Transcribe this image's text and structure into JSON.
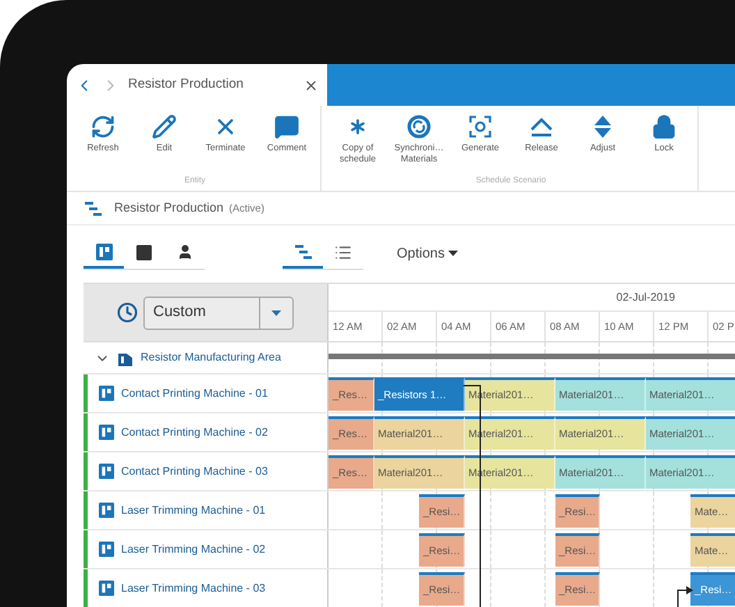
{
  "tab": {
    "title": "Resistor Production"
  },
  "ribbon": {
    "groups": [
      {
        "label": "Entity",
        "buttons": [
          {
            "kind": "refresh",
            "label": "Refresh"
          },
          {
            "kind": "edit",
            "label": "Edit"
          },
          {
            "kind": "terminate",
            "label": "Terminate"
          },
          {
            "kind": "comment",
            "label": "Comment"
          }
        ]
      },
      {
        "label": "Schedule Scenario",
        "buttons": [
          {
            "kind": "copy",
            "label": "Copy of schedule"
          },
          {
            "kind": "sync",
            "label": "Synchroni… Materials"
          },
          {
            "kind": "generate",
            "label": "Generate"
          },
          {
            "kind": "release",
            "label": "Release"
          },
          {
            "kind": "adjust",
            "label": "Adjust"
          },
          {
            "kind": "lock",
            "label": "Lock"
          }
        ]
      }
    ]
  },
  "schedule_title": {
    "name": "Resistor Production",
    "status": "(Active)"
  },
  "view_tabs": [
    {
      "kind": "resource",
      "selected": true
    },
    {
      "kind": "square",
      "selected": false
    },
    {
      "kind": "person",
      "selected": false
    }
  ],
  "mode_tabs": [
    {
      "kind": "gantt",
      "selected": true
    },
    {
      "kind": "list",
      "selected": false
    }
  ],
  "options_menu": {
    "label": "Options"
  },
  "range_select": {
    "value": "Custom"
  },
  "timeline": {
    "date": "02-Jul-2019",
    "hours": [
      "12 AM",
      "02 AM",
      "04 AM",
      "06 AM",
      "08 AM",
      "10 AM",
      "12 PM",
      "02 P"
    ]
  },
  "group": {
    "name": "Resistor Manufacturing Area",
    "expanded": true,
    "resources": [
      {
        "name": "Contact Printing Machine - 01",
        "bars": [
          {
            "kind": "bar",
            "long": false,
            "label": "_Res…",
            "color": "#e9a98b"
          },
          {
            "kind": "bar",
            "long": true,
            "label": "_Resistors 1…",
            "color": "#1f7cc1"
          },
          {
            "kind": "bar",
            "long": true,
            "label": "Material201…",
            "color": "#e7e49d"
          },
          {
            "kind": "bar",
            "long": true,
            "label": "Material201…",
            "color": "#a4e0dc"
          },
          {
            "kind": "bar",
            "long": true,
            "label": "Material201…",
            "color": "#a4e0dc"
          }
        ]
      },
      {
        "name": "Contact Printing Machine - 02",
        "bars": [
          {
            "kind": "bar",
            "long": false,
            "label": "_Res…",
            "color": "#e9a98b"
          },
          {
            "kind": "bar",
            "long": true,
            "label": "Material201…",
            "color": "#ebd49d"
          },
          {
            "kind": "bar",
            "long": true,
            "label": "Material201…",
            "color": "#e7e49d"
          },
          {
            "kind": "bar",
            "long": true,
            "label": "Material201…",
            "color": "#e7e49d"
          },
          {
            "kind": "bar",
            "long": true,
            "label": "Material201…",
            "color": "#a4e0dc"
          }
        ]
      },
      {
        "name": "Contact Printing Machine - 03",
        "bars": [
          {
            "kind": "bar",
            "long": false,
            "label": "_Res…",
            "color": "#e9a98b"
          },
          {
            "kind": "bar",
            "long": true,
            "label": "Material201…",
            "color": "#ebd49d"
          },
          {
            "kind": "bar",
            "long": true,
            "label": "Material201…",
            "color": "#e7e49d"
          },
          {
            "kind": "bar",
            "long": true,
            "label": "Material201…",
            "color": "#a4e0dc"
          },
          {
            "kind": "bar",
            "long": true,
            "label": "Material201…",
            "color": "#a4e0dc"
          }
        ]
      },
      {
        "name": "Laser Trimming Machine - 01",
        "bars": [
          {
            "kind": "gap"
          },
          {
            "kind": "bar",
            "long": false,
            "label": "_Resi…",
            "color": "#e9a98b"
          },
          {
            "kind": "gap"
          },
          {
            "kind": "bar",
            "long": false,
            "label": "_Resi…",
            "color": "#e9a98b"
          },
          {
            "kind": "gap"
          },
          {
            "kind": "bar",
            "long": false,
            "label": "Mate…",
            "color": "#ebd49d"
          }
        ]
      },
      {
        "name": "Laser Trimming Machine - 02",
        "bars": [
          {
            "kind": "gap"
          },
          {
            "kind": "bar",
            "long": false,
            "label": "_Resi…",
            "color": "#e9a98b"
          },
          {
            "kind": "gap"
          },
          {
            "kind": "bar",
            "long": false,
            "label": "_Resi…",
            "color": "#e9a98b"
          },
          {
            "kind": "gap"
          },
          {
            "kind": "bar",
            "long": false,
            "label": "Mate…",
            "color": "#ebd49d"
          }
        ]
      },
      {
        "name": "Laser Trimming Machine - 03",
        "bars": [
          {
            "kind": "gap"
          },
          {
            "kind": "bar",
            "long": false,
            "label": "_Resi…",
            "color": "#e9a98b"
          },
          {
            "kind": "gap"
          },
          {
            "kind": "bar",
            "long": false,
            "label": "_Resi…",
            "color": "#e9a98b"
          },
          {
            "kind": "gap"
          },
          {
            "kind": "bar",
            "long": false,
            "label": "_Resi…",
            "color": "#3b95d6"
          }
        ]
      }
    ]
  }
}
